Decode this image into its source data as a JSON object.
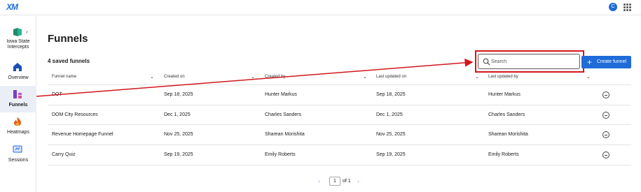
{
  "topbar": {
    "logo": "XM",
    "avatar_initial": "C"
  },
  "sidebar": {
    "project_name": "Iowa State Intercepts",
    "items": [
      {
        "label": "Overview",
        "icon": "home-icon",
        "active": false
      },
      {
        "label": "Funnels",
        "icon": "funnels-icon",
        "active": true
      },
      {
        "label": "Heatmaps",
        "icon": "flame-icon",
        "active": false
      },
      {
        "label": "Sessions",
        "icon": "sessions-icon",
        "active": false
      }
    ]
  },
  "main": {
    "title": "Funnels",
    "saved_count": "4 saved funnels",
    "search": {
      "placeholder": "Search",
      "value": ""
    },
    "create_button": "Create funnel",
    "accent_color": "#1f6bd8",
    "highlight_color": "#d0181c"
  },
  "table": {
    "columns": [
      "Funnel name",
      "Created on",
      "Created by",
      "Last updated on",
      "Last updated by"
    ],
    "rows": [
      {
        "name": "DOT",
        "created_on": "Sep 18, 2025",
        "created_by": "Hunter Markus",
        "updated_on": "Sep 18, 2025",
        "updated_by": "Hunter Markus"
      },
      {
        "name": "DOM City Resources",
        "created_on": "Dec 1, 2025",
        "created_by": "Charles Sanders",
        "updated_on": "Dec 1, 2025",
        "updated_by": "Charles Sanders"
      },
      {
        "name": "Revenue Homepage Funnel",
        "created_on": "Nov 25, 2025",
        "created_by": "Sharean Morishita",
        "updated_on": "Nov 25, 2025",
        "updated_by": "Sharean Morishita"
      },
      {
        "name": "Carry Quiz",
        "created_on": "Sep 19, 2025",
        "created_by": "Emily Roberts",
        "updated_on": "Sep 19, 2025",
        "updated_by": "Emily Roberts"
      }
    ]
  },
  "pagination": {
    "current_page": "1",
    "of_label": "of 1"
  }
}
